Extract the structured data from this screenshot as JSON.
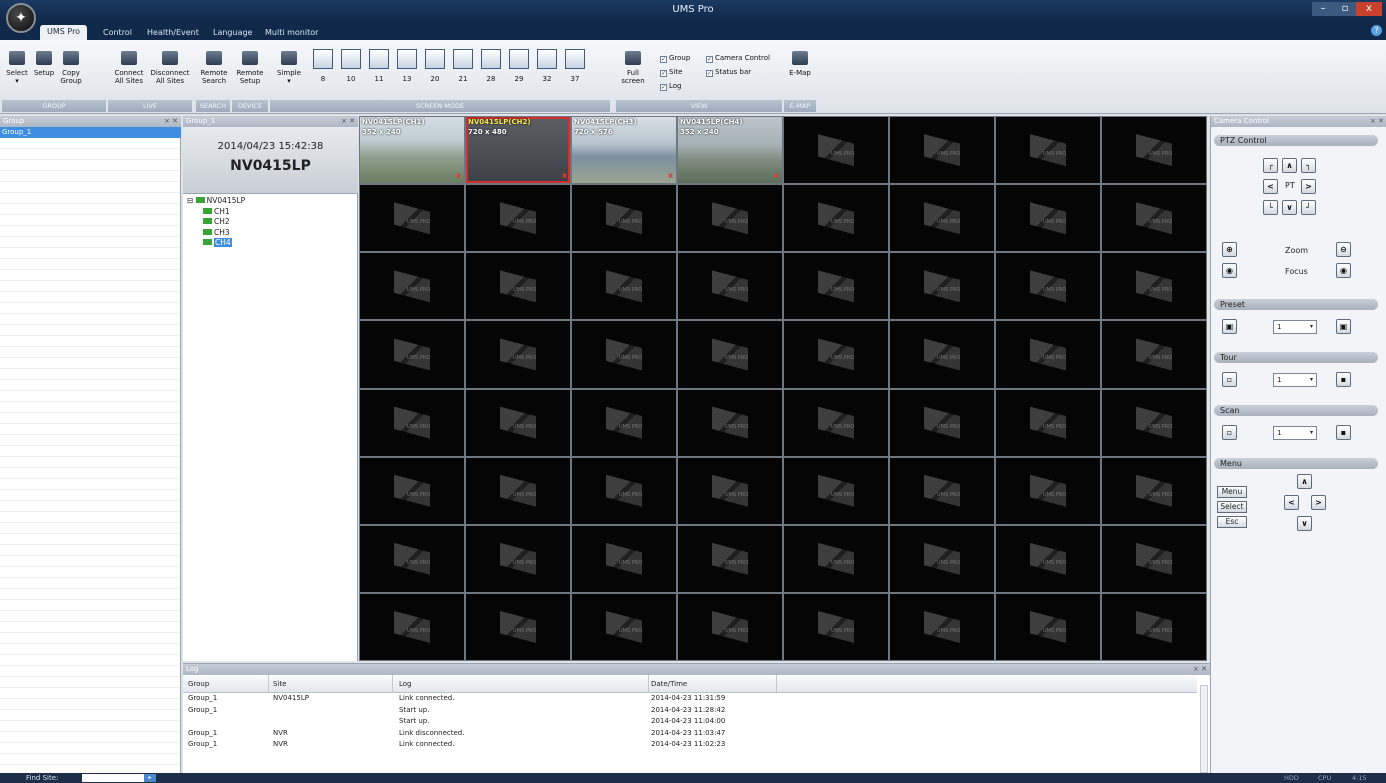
{
  "window": {
    "title": "UMS Pro",
    "logo_glyph": "✦",
    "min": "–",
    "max": "▫",
    "close": "x"
  },
  "ribbon_tabs": [
    "UMS Pro",
    "Control",
    "Health/Event",
    "Language",
    "Multi monitor"
  ],
  "help_glyph": "?",
  "ribbon": {
    "group_buttons": [
      {
        "label": "Select",
        "sub": "▾"
      },
      {
        "label": "Setup",
        "sub": ""
      },
      {
        "label": "Copy",
        "sub": "Group"
      }
    ],
    "live_buttons": [
      {
        "label": "Connect",
        "sub": "All Sites"
      },
      {
        "label": "Disconnect",
        "sub": "All Sites"
      }
    ],
    "search_button": {
      "label": "Remote",
      "sub": "Search"
    },
    "device_button": {
      "label": "Remote",
      "sub": "Setup"
    },
    "simple_button": {
      "label": "Simple",
      "sub": "▾"
    },
    "screen_modes": [
      "8",
      "10",
      "11",
      "13",
      "20",
      "21",
      "28",
      "29",
      "32",
      "37"
    ],
    "fullscreen": {
      "label": "Full",
      "sub": "screen"
    },
    "view_checks": [
      {
        "label": "Group",
        "checked": true
      },
      {
        "label": "Camera Control",
        "checked": true
      },
      {
        "label": "Site",
        "checked": true
      },
      {
        "label": "Status bar",
        "checked": true
      },
      {
        "label": "Log",
        "checked": true
      }
    ],
    "emap_button": {
      "label": "E-Map"
    },
    "group_labels": {
      "group": "GROUP",
      "live": "LIVE",
      "search": "SEARCH",
      "device": "DEVICE",
      "screen_mode": "SCREEN MODE",
      "view": "VIEW",
      "emap": "E-MAP"
    }
  },
  "group_panel": {
    "title": "Group",
    "items": [
      "Group_1"
    ]
  },
  "site_panel": {
    "title": "Group_1",
    "datetime": "2014/04/23 15:42:38",
    "site_name": "NV0415LP",
    "tree_root": "NV0415LP",
    "channels": [
      "CH1",
      "CH2",
      "CH3",
      "CH4"
    ]
  },
  "pin_close": "⨯ ✕",
  "video": {
    "live_channels": [
      {
        "title": "NV0415LP(CH1)",
        "resolution": "352 x 240",
        "rec": "R"
      },
      {
        "title": "NV0415LP(CH2)",
        "resolution": "720 x 480",
        "rec": "R"
      },
      {
        "title": "NV0415LP(CH3)",
        "resolution": "720 x 576",
        "rec": "R"
      },
      {
        "title": "NV0415LP(CH4)",
        "resolution": "352 x 240",
        "rec": "R"
      }
    ],
    "placeholder_text": "UMS PRO"
  },
  "camera_control": {
    "title": "Camera Control",
    "ptz_title": "PTZ Control",
    "ptz_label": "PT",
    "zoom_label": "Zoom",
    "focus_label": "Focus",
    "preset_title": "Preset",
    "preset_value": "1",
    "tour_title": "Tour",
    "tour_value": "1",
    "scan_title": "Scan",
    "scan_value": "1",
    "menu_title": "Menu",
    "menu_buttons": [
      "Menu",
      "Select",
      "Esc"
    ],
    "glyphs": {
      "ul": "┌",
      "up": "∧",
      "ur": "┐",
      "left": "<",
      "right": ">",
      "dl": "└",
      "down": "∨",
      "dr": "┘",
      "dot": "◉",
      "arrow": "▾"
    }
  },
  "log": {
    "title": "Log",
    "columns": [
      "Group",
      "Site",
      "Log",
      "Date/Time"
    ],
    "rows": [
      [
        "Group_1",
        "NV0415LP",
        "Link connected.",
        "2014-04-23 11:31:59"
      ],
      [
        "Group_1",
        "",
        "Start up.",
        "2014-04-23 11:28:42"
      ],
      [
        "",
        "",
        "Start up.",
        "2014-04-23 11:04:00"
      ],
      [
        "Group_1",
        "NVR",
        "Link disconnected.",
        "2014-04-23 11:03:47"
      ],
      [
        "Group_1",
        "NVR",
        "Link connected.",
        "2014-04-23 11:02:23"
      ]
    ]
  },
  "statusbar": {
    "find_label": "Find Site:",
    "go_glyph": "▸",
    "items": [
      "HDD",
      "CPU",
      "4:15"
    ]
  }
}
